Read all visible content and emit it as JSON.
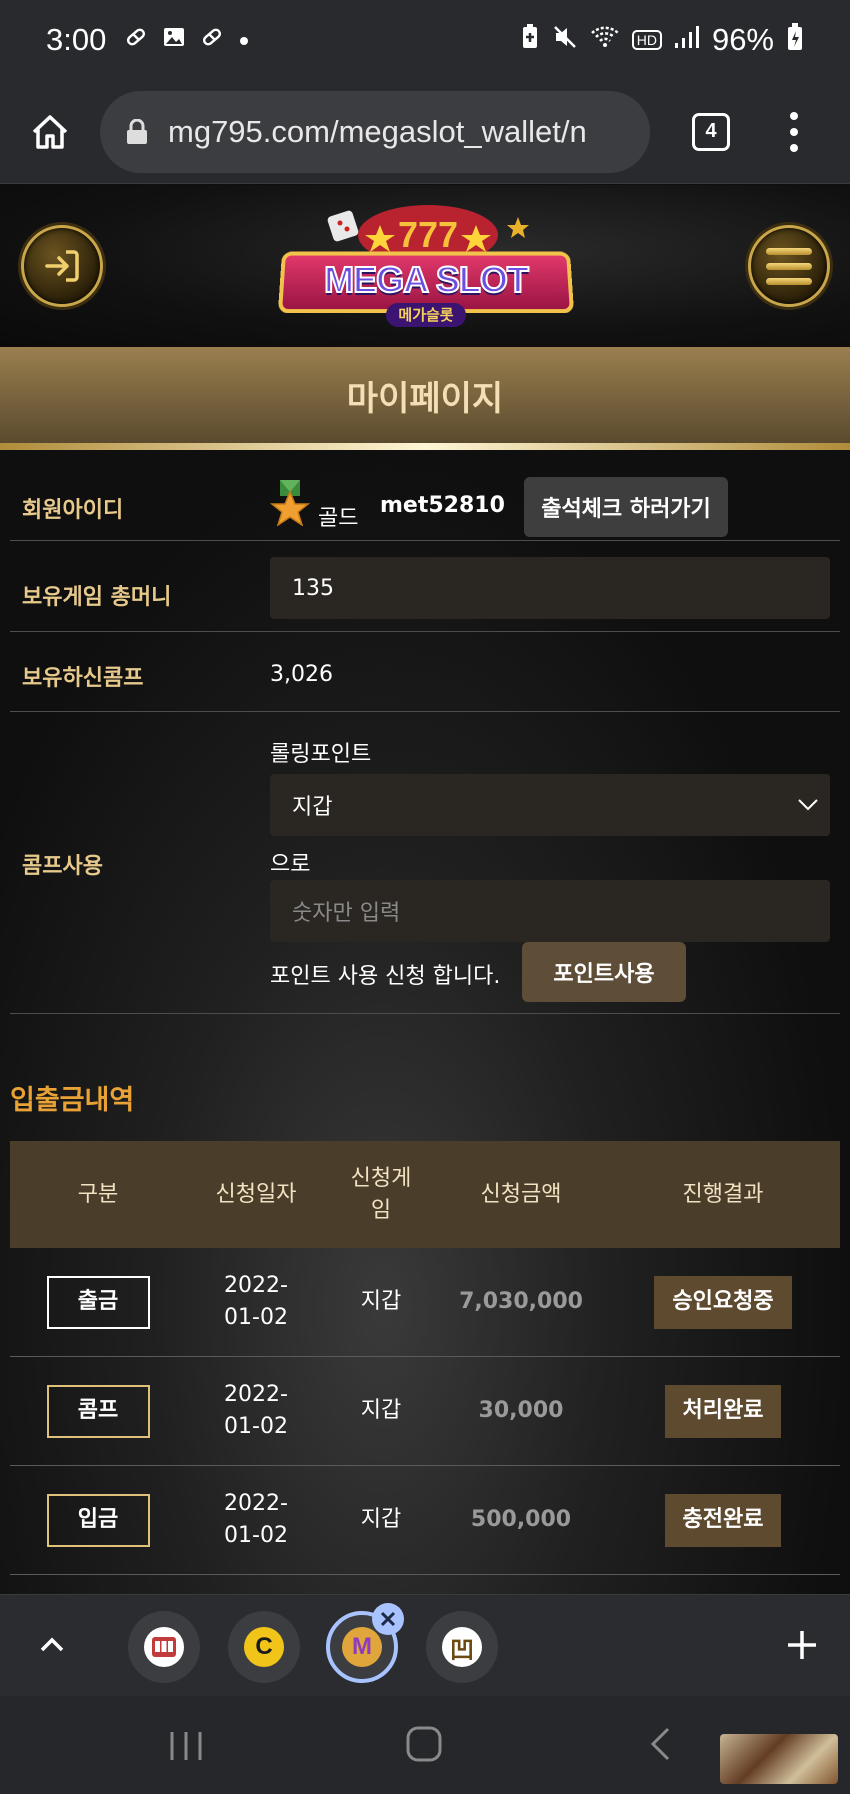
{
  "status_bar": {
    "time": "3:00",
    "battery": "96%",
    "hd_label": "HD",
    "icons_left": [
      "pill-icon",
      "image-icon",
      "pill-icon",
      "dot-icon"
    ],
    "icons_right": [
      "battery-saver-icon",
      "mute-icon",
      "wifi-icon",
      "hd-badge",
      "signal-icon",
      "battery-icon"
    ]
  },
  "browser": {
    "url": "mg795.com/megaslot_wallet/n",
    "tab_count": "4"
  },
  "header": {
    "logo_text": "MEGA SLOT",
    "logo_sub": "메가슬롯"
  },
  "page": {
    "title": "마이페이지"
  },
  "account": {
    "member_id_label": "회원아이디",
    "grade": "골드",
    "member_id": "met52810",
    "attendance_button": "출석체크 하러가기",
    "game_money_label": "보유게임 총머니",
    "game_money_value": "135",
    "comp_label": "보유하신콤프",
    "comp_value": "3,026"
  },
  "comp_use": {
    "label": "콤프사용",
    "rolling_label": "롤링포인트",
    "select_value": "지갑",
    "to_label": "으로",
    "amount_placeholder": "숫자만 입력",
    "apply_text": "포인트 사용 신청 합니다.",
    "apply_button": "포인트사용"
  },
  "history": {
    "title": "입출금내역",
    "columns": [
      "구분",
      "신청일자",
      "신청게\n임",
      "신청금액",
      "진행결과"
    ],
    "rows": [
      {
        "type": "출금",
        "date": "2022-\n01-02",
        "game": "지갑",
        "amount": "7,030,000",
        "status": "승인요청중"
      },
      {
        "type": "콤프",
        "date": "2022-\n01-02",
        "game": "지갑",
        "amount": "30,000",
        "status": "처리완료"
      },
      {
        "type": "입금",
        "date": "2022-\n01-02",
        "game": "지갑",
        "amount": "500,000",
        "status": "충전완료"
      }
    ]
  },
  "tab_strip": {
    "tabs": [
      {
        "icon": "slot-machine-icon",
        "glyph": "777",
        "color": "#c23b3b"
      },
      {
        "icon": "c-logo-icon",
        "glyph": "C",
        "color": "#f0c419"
      },
      {
        "icon": "m-logo-icon",
        "glyph": "M",
        "color": "#8e3cbf"
      },
      {
        "icon": "game-board-icon",
        "glyph": "凹",
        "color": "#d9b35a"
      }
    ]
  },
  "colors": {
    "accent_gold": "#e7c98c",
    "section_orange": "#e8a235",
    "title_bar": "#9a7f4f",
    "status_brown": "#5e4a2f"
  }
}
